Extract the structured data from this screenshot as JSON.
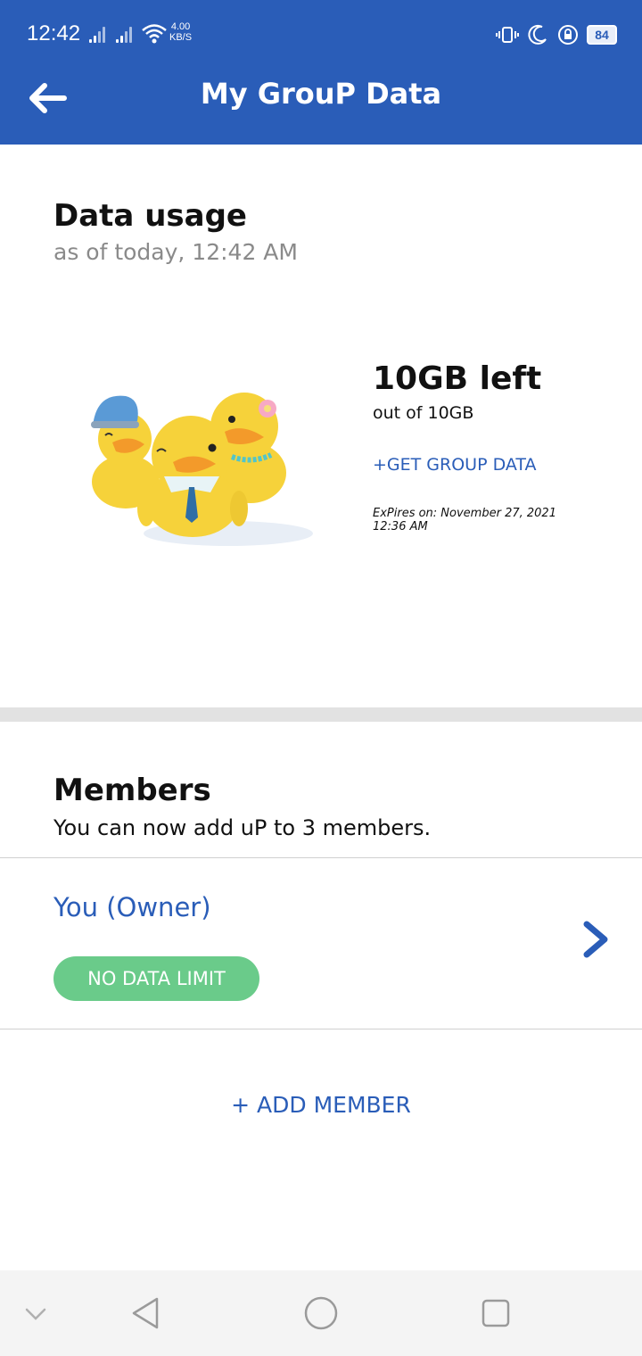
{
  "status_bar": {
    "time": "12:42",
    "speed_value": "4.00",
    "speed_unit": "KB/S",
    "battery": "84",
    "icons": [
      "signal-icon",
      "signal-icon",
      "wifi-icon",
      "vibrate-icon",
      "moon-icon",
      "rotation-lock-icon",
      "battery-icon"
    ]
  },
  "app_bar": {
    "title": "My GrouP Data",
    "back_icon": "back-arrow-icon"
  },
  "usage": {
    "title": "Data usage",
    "subtitle": "as of today, 12:42 AM",
    "left_label": "10GB left",
    "out_of_label": "out of 10GB",
    "get_data_label": "+GET GROUP DATA",
    "expires_label": "ExPires on: November 27, 2021 12:36 AM",
    "illustration": "three-ducks-illustration"
  },
  "members": {
    "title": "Members",
    "subtitle": "You can now add uP to 3 members.",
    "rows": [
      {
        "name": "You (Owner)",
        "badge": "NO DATA LIMIT"
      }
    ],
    "add_label": "+ ADD MEMBER"
  },
  "colors": {
    "primary": "#2a5db8",
    "badge": "#6acb8a",
    "divider": "#e2e2e2"
  },
  "nav_bar": {
    "icons": [
      "chevron-down-icon",
      "back-triangle-icon",
      "home-circle-icon",
      "recents-square-icon"
    ]
  }
}
